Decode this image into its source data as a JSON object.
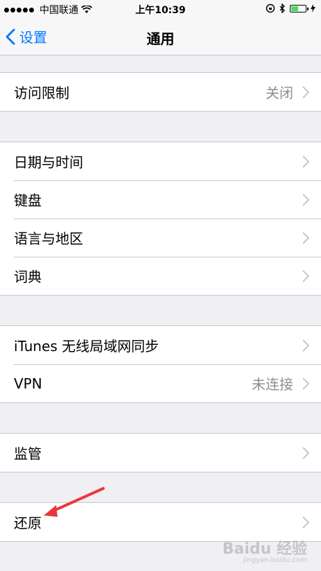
{
  "status_bar": {
    "carrier": "中国联通",
    "time": "上午10:39"
  },
  "nav": {
    "back_label": "设置",
    "title": "通用"
  },
  "groups": [
    {
      "items": [
        {
          "label": "访问限制",
          "value": "关闭"
        }
      ]
    },
    {
      "items": [
        {
          "label": "日期与时间",
          "value": ""
        },
        {
          "label": "键盘",
          "value": ""
        },
        {
          "label": "语言与地区",
          "value": ""
        },
        {
          "label": "词典",
          "value": ""
        }
      ]
    },
    {
      "items": [
        {
          "label": "iTunes 无线局域网同步",
          "value": ""
        },
        {
          "label": "VPN",
          "value": "未连接"
        }
      ]
    },
    {
      "items": [
        {
          "label": "监管",
          "value": ""
        }
      ]
    },
    {
      "items": [
        {
          "label": "还原",
          "value": ""
        }
      ]
    }
  ],
  "watermark": {
    "brand": "Baidu 经验",
    "url": "jingyan.baidu.com"
  },
  "colors": {
    "accent": "#007aff",
    "annotation_arrow": "#e8383d"
  }
}
